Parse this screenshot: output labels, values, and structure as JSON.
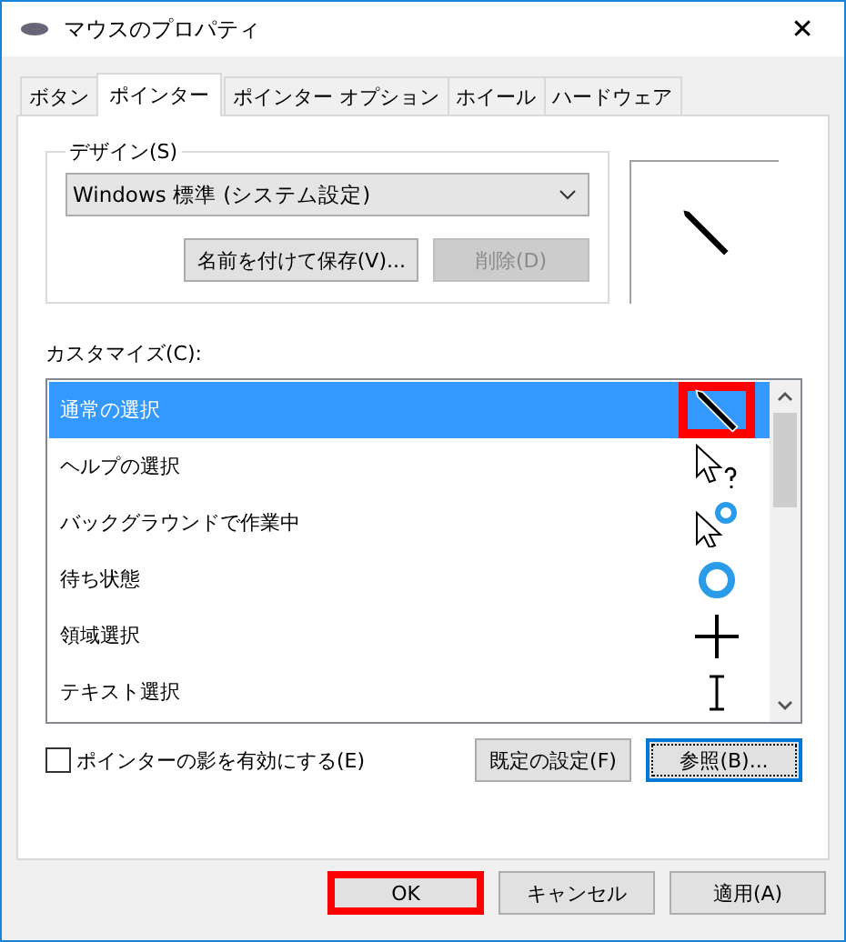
{
  "window": {
    "title": "マウスのプロパティ",
    "close": "✕"
  },
  "tabs": [
    {
      "label": "ボタン",
      "selected": false
    },
    {
      "label": "ポインター",
      "selected": true
    },
    {
      "label": "ポインター オプション",
      "selected": false
    },
    {
      "label": "ホイール",
      "selected": false
    },
    {
      "label": "ハードウェア",
      "selected": false
    }
  ],
  "design": {
    "label": "デザイン(S)",
    "value": "Windows 標準 (システム設定)",
    "buttons": [
      {
        "label": "名前を付けて保存(V)...",
        "disabled": false
      },
      {
        "label": "削除(D)",
        "disabled": true
      }
    ]
  },
  "customize": {
    "label": "カスタマイズ(C):",
    "items": [
      {
        "label": "通常の選択",
        "kind": "pen",
        "selected": true,
        "highlighted": true
      },
      {
        "label": "ヘルプの選択",
        "kind": "help",
        "selected": false,
        "highlighted": false
      },
      {
        "label": "バックグラウンドで作業中",
        "kind": "busy-arrow",
        "selected": false,
        "highlighted": false
      },
      {
        "label": "待ち状態",
        "kind": "ring",
        "selected": false,
        "highlighted": false
      },
      {
        "label": "領域選択",
        "kind": "cross",
        "selected": false,
        "highlighted": false
      },
      {
        "label": "テキスト選択",
        "kind": "ibeam",
        "selected": false,
        "highlighted": false
      }
    ]
  },
  "shadow": {
    "label": "ポインターの影を有効にする(E)",
    "checked": false
  },
  "list_buttons": [
    {
      "label": "既定の設定(F)",
      "focused": false
    },
    {
      "label": "参照(B)...",
      "focused": true
    }
  ],
  "footer_buttons": [
    {
      "label": "OK",
      "highlighted": true
    },
    {
      "label": "キャンセル",
      "highlighted": false
    },
    {
      "label": "適用(A)",
      "highlighted": false
    }
  ]
}
